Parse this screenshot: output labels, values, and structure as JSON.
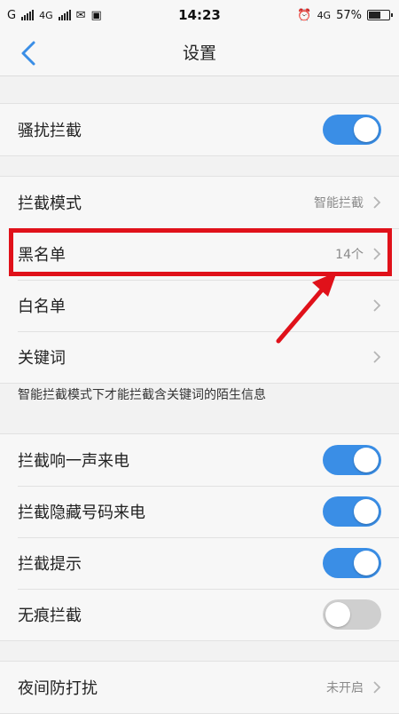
{
  "status_bar": {
    "carrier1": "G",
    "carrier2": "4G",
    "time": "14:23",
    "network_right": "4G",
    "battery": "57%",
    "battery_level": 0.57
  },
  "nav": {
    "title": "设置",
    "back_icon": "chevron-left-icon"
  },
  "harassment": {
    "label": "骚扰拦截",
    "enabled": true
  },
  "block_group": [
    {
      "label": "拦截模式",
      "value": "智能拦截"
    },
    {
      "label": "黑名单",
      "value": "14个"
    },
    {
      "label": "白名单",
      "value": ""
    },
    {
      "label": "关键词",
      "value": ""
    }
  ],
  "keyword_note": "智能拦截模式下才能拦截含关键词的陌生信息",
  "toggles": [
    {
      "label": "拦截响一声来电",
      "enabled": true
    },
    {
      "label": "拦截隐藏号码来电",
      "enabled": true
    },
    {
      "label": "拦截提示",
      "enabled": true
    },
    {
      "label": "无痕拦截",
      "enabled": false
    }
  ],
  "night": {
    "label": "夜间防打扰",
    "value": "未开启"
  },
  "colors": {
    "accent": "#3a8ee6",
    "annotation": "#e0111a"
  }
}
